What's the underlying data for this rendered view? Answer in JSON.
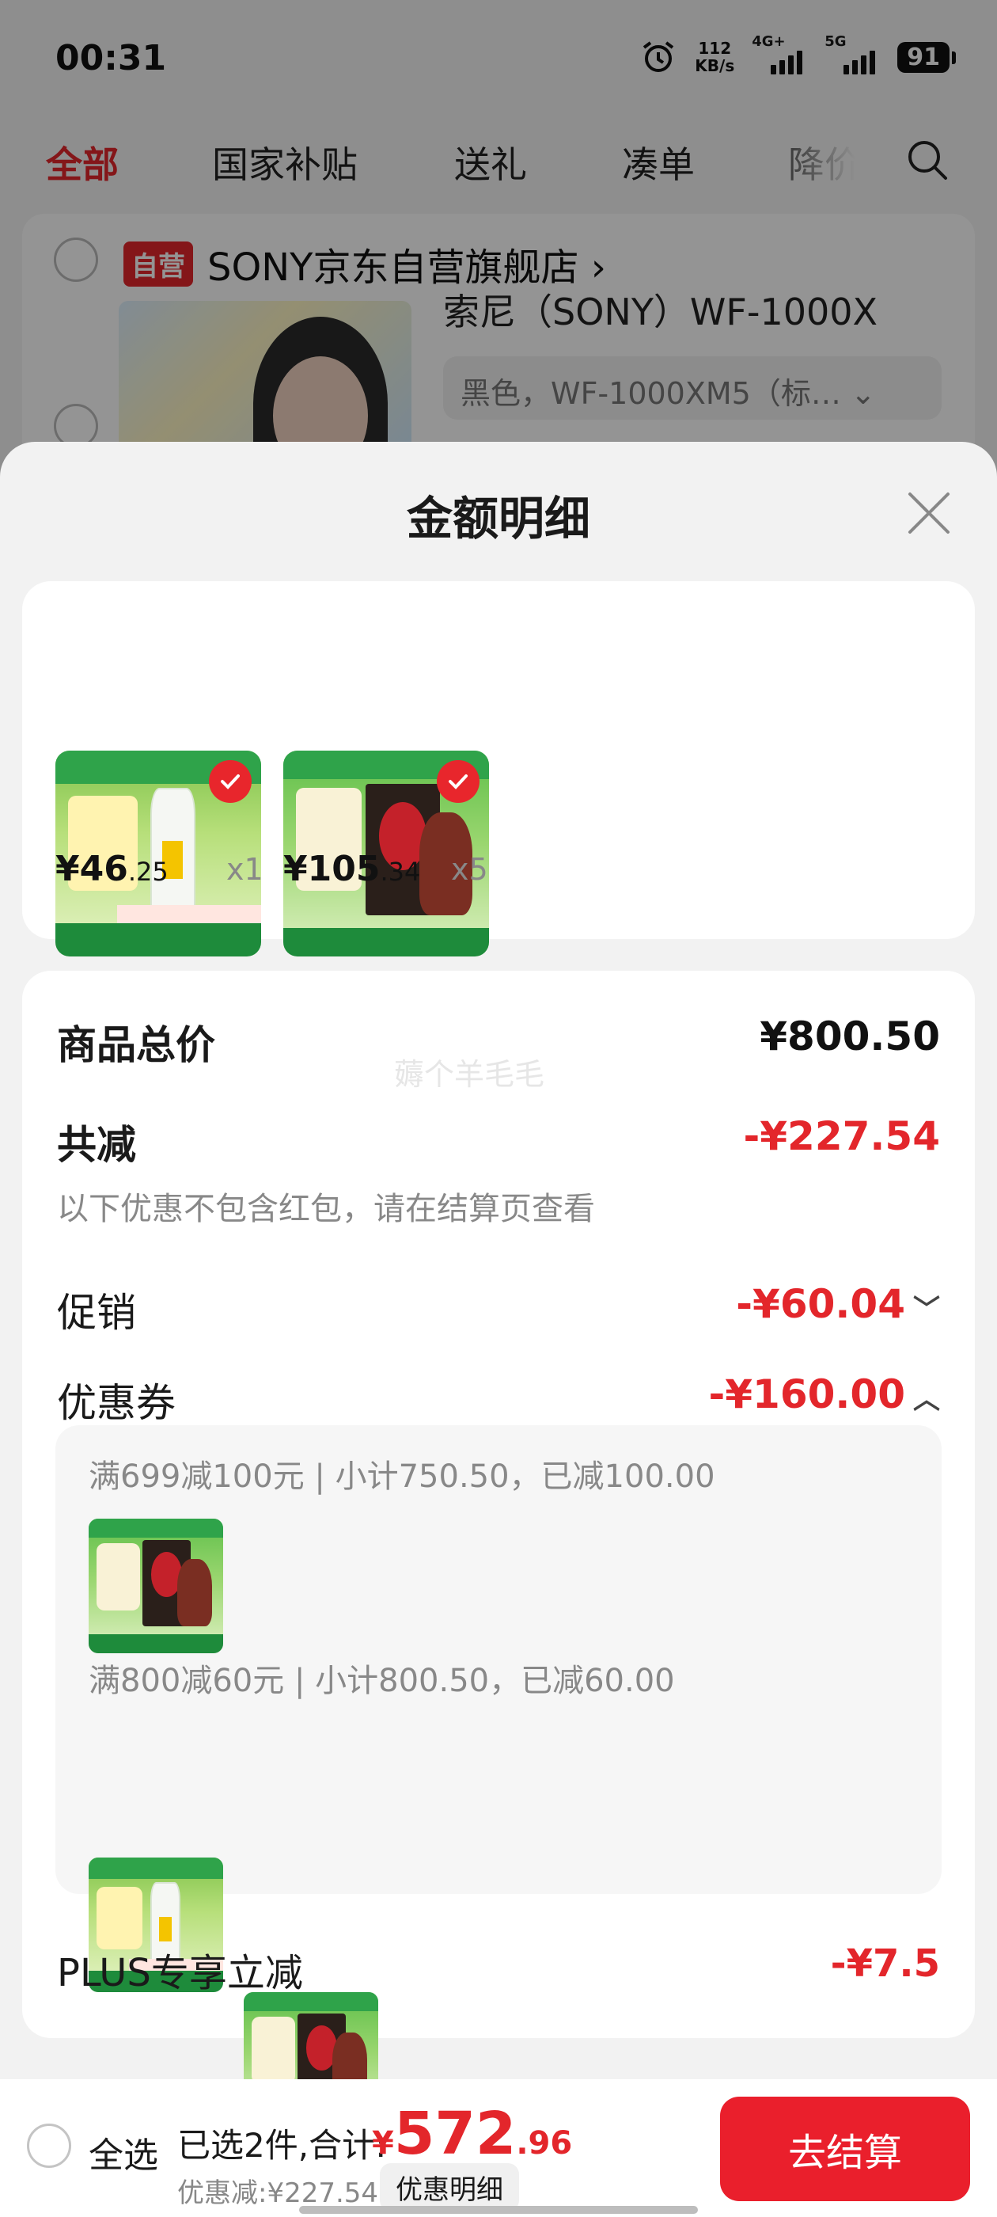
{
  "status_bar": {
    "time": "00:31",
    "net_speed_value": "112",
    "net_speed_unit": "KB/s",
    "signal_1": "4G+",
    "signal_2": "5G",
    "battery": "91"
  },
  "tabs": [
    {
      "label": "全部",
      "active": true
    },
    {
      "label": "国家补贴",
      "active": false
    },
    {
      "label": "送礼",
      "active": false
    },
    {
      "label": "凑单",
      "active": false
    },
    {
      "label": "降价",
      "active": false
    }
  ],
  "store": {
    "badge": "自营",
    "name": "SONY京东自营旗舰店 ›",
    "product_title": "索尼（SONY）WF-1000X",
    "sku": "黑色，WF-1000XM5（标…  ⌄"
  },
  "sheet": {
    "title": "金额明细",
    "items": [
      {
        "price_int": "¥46",
        "price_dec": ".25",
        "qty": "x1",
        "art": "liquor"
      },
      {
        "price_int": "¥105",
        "price_dec": ".34",
        "qty": "x5",
        "art": "jar"
      }
    ],
    "watermark": "薅个羊毛毛",
    "total_label": "商品总价",
    "total_value": "¥800.50",
    "reduce_label": "共减",
    "reduce_value": "-¥227.54",
    "reduce_note": "以下优惠不包含红包，请在结算页查看",
    "promo_label": "促销",
    "promo_value": "-¥60.04",
    "promo_chevron": "﹀",
    "coupon_label": "优惠券",
    "coupon_value": "-¥160.00",
    "coupon_chevron": "︿",
    "coupons": [
      {
        "text": "满699减100元 | 小计750.50，已减100.00",
        "items": [
          "jar"
        ]
      },
      {
        "text": "满800减60元 | 小计800.50，已减60.00",
        "items": [
          "liquor",
          "jar"
        ]
      }
    ],
    "plus_label": "PLUS专享立减",
    "plus_value": "-¥7.5"
  },
  "bottom_bar": {
    "select_all": "全选",
    "selected_text": "已选2件,合计:",
    "total_currency": "¥",
    "total_int": "572",
    "total_dec": ".96",
    "discount_text": "优惠减:¥227.54",
    "detail_button": "优惠明细",
    "checkout_button": "去结算"
  },
  "colors": {
    "accent_red": "#e3262b",
    "checkout_red": "#ea1f2c"
  }
}
